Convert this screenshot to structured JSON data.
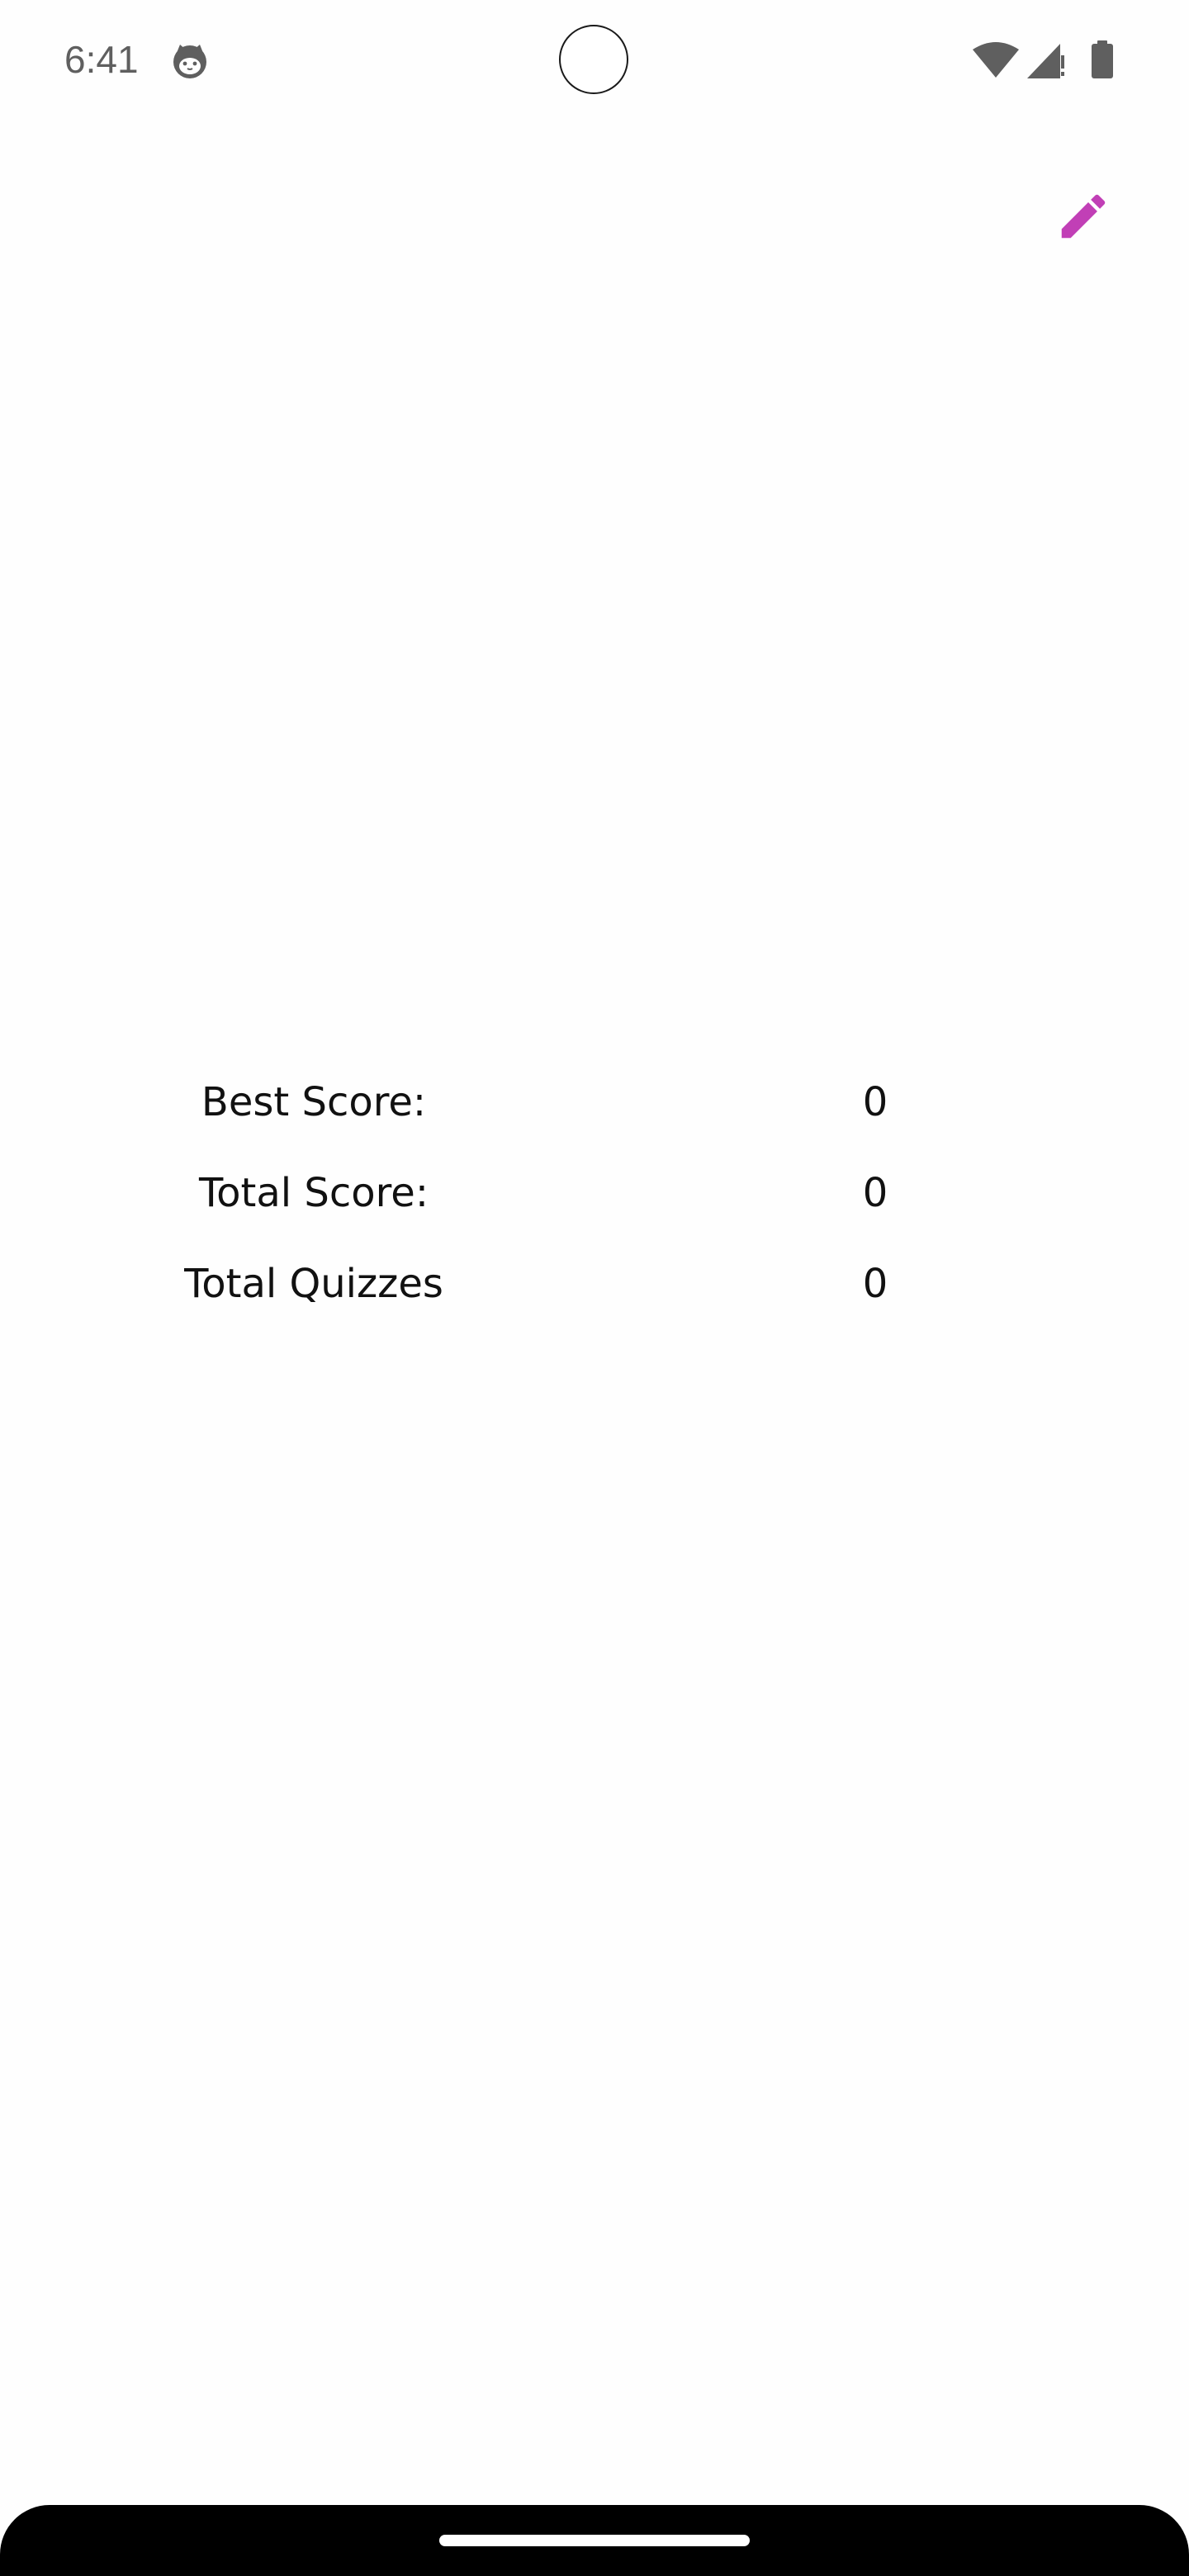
{
  "status_bar": {
    "time": "6:41",
    "icons": [
      "cat-face-icon",
      "wifi-icon",
      "cellular-signal-icon",
      "battery-icon"
    ]
  },
  "toolbar": {
    "edit_icon": "pencil-icon",
    "accent_color": "#c13fb6"
  },
  "stats": [
    {
      "label": "Best Score:",
      "value": "0"
    },
    {
      "label": "Total Score:",
      "value": "0"
    },
    {
      "label": "Total Quizzes",
      "value": "0"
    }
  ]
}
